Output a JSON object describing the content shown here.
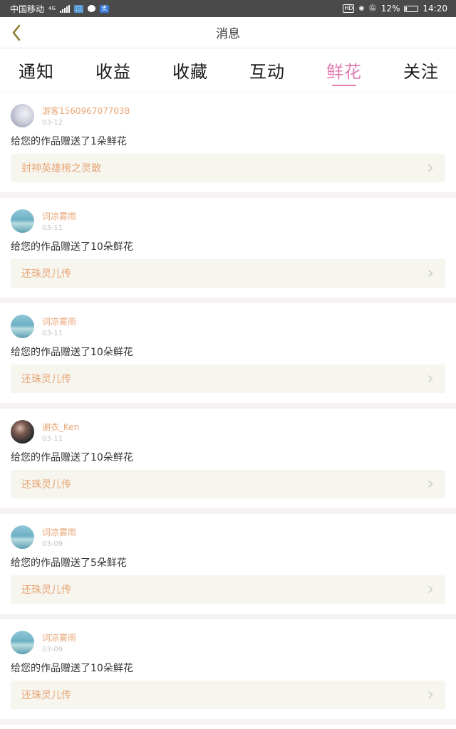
{
  "status_bar": {
    "carrier": "中国移动",
    "network": "4G",
    "battery_text": "12%",
    "battery_level": 0.12,
    "time": "14:20",
    "hd_label": "HD"
  },
  "nav": {
    "title": "消息"
  },
  "tabs": [
    {
      "label": "通知",
      "active": false
    },
    {
      "label": "收益",
      "active": false
    },
    {
      "label": "收藏",
      "active": false
    },
    {
      "label": "互动",
      "active": false
    },
    {
      "label": "鲜花",
      "active": true
    },
    {
      "label": "关注",
      "active": false
    }
  ],
  "colors": {
    "accent_pink": "#e07ab0",
    "username_orange": "#e8a576",
    "link_bg": "#f6f5ee"
  },
  "items": [
    {
      "username": "游客1560967077038",
      "date": "03-12",
      "message": "给您的作品赠送了1朵鲜花",
      "work": "封神英雄榜之灵散",
      "avatar": "avatar-anime"
    },
    {
      "username": "词凉雾雨",
      "date": "03-11",
      "message": "给您的作品赠送了10朵鲜花",
      "work": "还珠灵儿传",
      "avatar": "avatar-sea"
    },
    {
      "username": "词凉雾雨",
      "date": "03-11",
      "message": "给您的作品赠送了10朵鲜花",
      "work": "还珠灵儿传",
      "avatar": "avatar-sea"
    },
    {
      "username": "谢衣_Ken",
      "date": "03-11",
      "message": "给您的作品赠送了10朵鲜花",
      "work": "还珠灵儿传",
      "avatar": "avatar-dark"
    },
    {
      "username": "词凉雾雨",
      "date": "03-09",
      "message": "给您的作品赠送了5朵鲜花",
      "work": "还珠灵儿传",
      "avatar": "avatar-sea"
    },
    {
      "username": "词凉雾雨",
      "date": "03-09",
      "message": "给您的作品赠送了10朵鲜花",
      "work": "还珠灵儿传",
      "avatar": "avatar-sea"
    }
  ]
}
